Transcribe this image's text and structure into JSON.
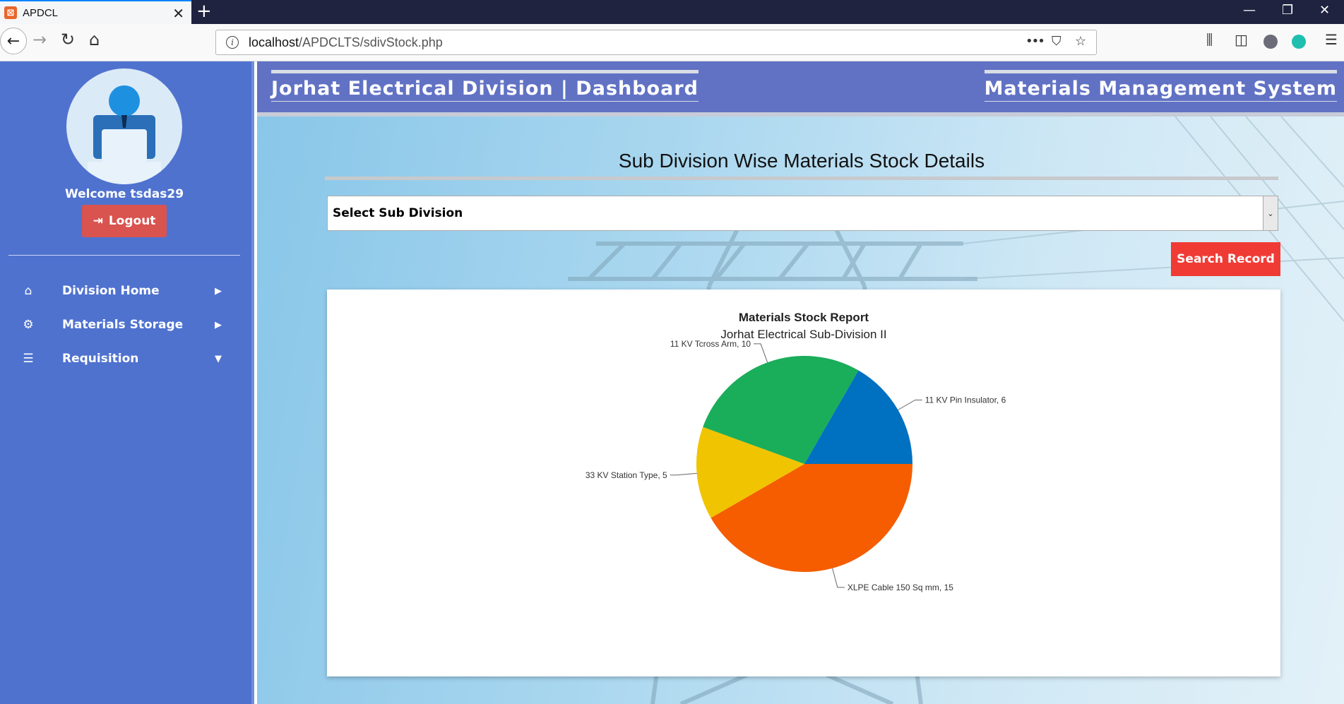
{
  "browser": {
    "tab_title": "APDCL",
    "favicon_glyph": "⊠",
    "url_host": "localhost",
    "url_path": "/APDCLTS/sdivStock.php"
  },
  "sidebar": {
    "welcome_text": "Welcome tsdas29",
    "logout_label": "Logout",
    "items": [
      {
        "label": "Division Home",
        "icon": "home-icon"
      },
      {
        "label": "Materials Storage",
        "icon": "gear-icon"
      },
      {
        "label": "Requisition",
        "icon": "list-icon"
      }
    ]
  },
  "header": {
    "left_title": "Jorhat Electrical Division | Dashboard",
    "right_title": "Materials Management System"
  },
  "main": {
    "heading": "Sub Division Wise Materials Stock Details",
    "select_label": "Select Sub Division",
    "search_button": "Search Record"
  },
  "colors": {
    "sidebar": "#4f72cf",
    "header": "#6172c4",
    "search_button": "#f03b35",
    "logout_button": "#d9534f"
  },
  "chart_data": {
    "type": "pie",
    "title": "Materials Stock Report",
    "subtitle": "Jorhat Electrical Sub-Division II",
    "slices": [
      {
        "label": "11 KV Pin Insulator",
        "value": 6,
        "color": "#0070c0"
      },
      {
        "label": "XLPE Cable 150 Sq mm",
        "value": 15,
        "color": "#f55d00"
      },
      {
        "label": "33 KV Station Type",
        "value": 5,
        "color": "#f0c400"
      },
      {
        "label": "11 KV Tcross Arm",
        "value": 10,
        "color": "#1aad5a"
      }
    ]
  }
}
